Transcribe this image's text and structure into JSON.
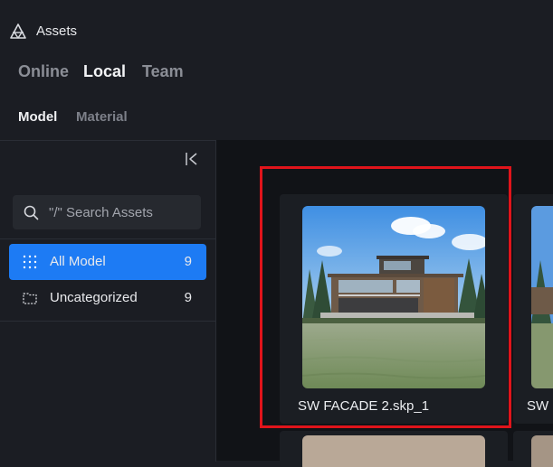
{
  "app": {
    "title": "Assets",
    "icon": "assets-logo-icon"
  },
  "scope_tabs": [
    {
      "label": "Online",
      "active": false
    },
    {
      "label": "Local",
      "active": true
    },
    {
      "label": "Team",
      "active": false
    }
  ],
  "type_tabs": [
    {
      "label": "Model",
      "active": true
    },
    {
      "label": "Material",
      "active": false
    }
  ],
  "sidebar": {
    "collapse_icon": "collapse-left-icon",
    "search": {
      "placeholder": "\"/\" Search Assets",
      "value": ""
    },
    "items": [
      {
        "label": "All Model",
        "count": "9",
        "icon": "grid-dots-icon",
        "active": true
      },
      {
        "label": "Uncategorized",
        "count": "9",
        "icon": "folder-outline-icon",
        "active": false
      }
    ]
  },
  "assets": [
    {
      "label": "SW FACADE 2.skp_1"
    },
    {
      "label": "SW"
    }
  ],
  "colors": {
    "accent": "#1d7bf4",
    "highlight": "#e0141b"
  }
}
